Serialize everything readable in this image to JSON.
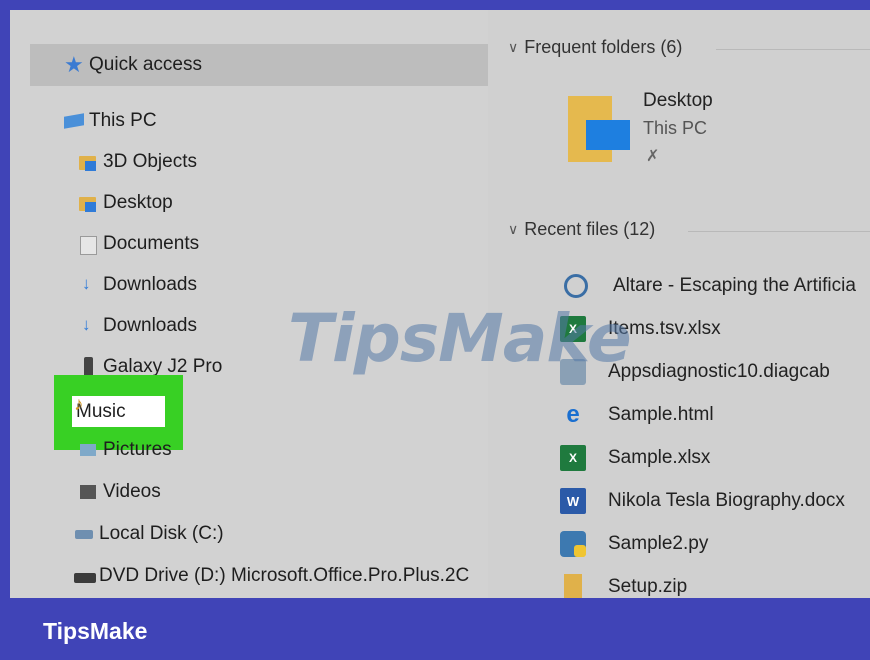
{
  "navigation": {
    "quick_access": "Quick access",
    "this_pc": "This PC",
    "items": [
      {
        "label": "3D Objects",
        "icon": "3d-objects-folder-icon"
      },
      {
        "label": "Desktop",
        "icon": "desktop-folder-icon"
      },
      {
        "label": "Documents",
        "icon": "documents-folder-icon"
      },
      {
        "label": "Downloads",
        "icon": "downloads-folder-icon"
      },
      {
        "label": "Downloads",
        "icon": "downloads-folder-icon"
      },
      {
        "label": "Galaxy J2 Pro",
        "icon": "phone-icon"
      },
      {
        "label": "Music",
        "icon": "music-folder-icon"
      },
      {
        "label": "Pictures",
        "icon": "pictures-folder-icon"
      },
      {
        "label": "Videos",
        "icon": "videos-folder-icon"
      },
      {
        "label": "Local Disk (C:)",
        "icon": "local-disk-icon"
      },
      {
        "label": "DVD Drive (D:) Microsoft.Office.Pro.Plus.2C",
        "icon": "dvd-drive-icon"
      }
    ],
    "highlight_color": "#38d024"
  },
  "frequent_folders": {
    "header": "Frequent folders (6)",
    "item": {
      "title": "Desktop",
      "subtitle": "This PC",
      "pinned": true
    }
  },
  "recent_files": {
    "header": "Recent files (12)",
    "items": [
      {
        "name": "Altare - Escaping the Artificia",
        "icon": "media-file-icon"
      },
      {
        "name": "Items.tsv.xlsx",
        "icon": "excel-icon"
      },
      {
        "name": "Appsdiagnostic10.diagcab",
        "icon": "diagcab-icon"
      },
      {
        "name": "Sample.html",
        "icon": "edge-icon"
      },
      {
        "name": "Sample.xlsx",
        "icon": "excel-icon"
      },
      {
        "name": "Nikola Tesla Biography.docx",
        "icon": "word-icon"
      },
      {
        "name": "Sample2.py",
        "icon": "python-icon"
      },
      {
        "name": "Setup.zip",
        "icon": "zip-icon"
      }
    ]
  },
  "watermark": "TipsMake",
  "footer": {
    "brand": "TipsMake"
  },
  "colors": {
    "border": "#4044b7",
    "panel": "#d0d0d0",
    "selection": "#bdbdbd"
  }
}
